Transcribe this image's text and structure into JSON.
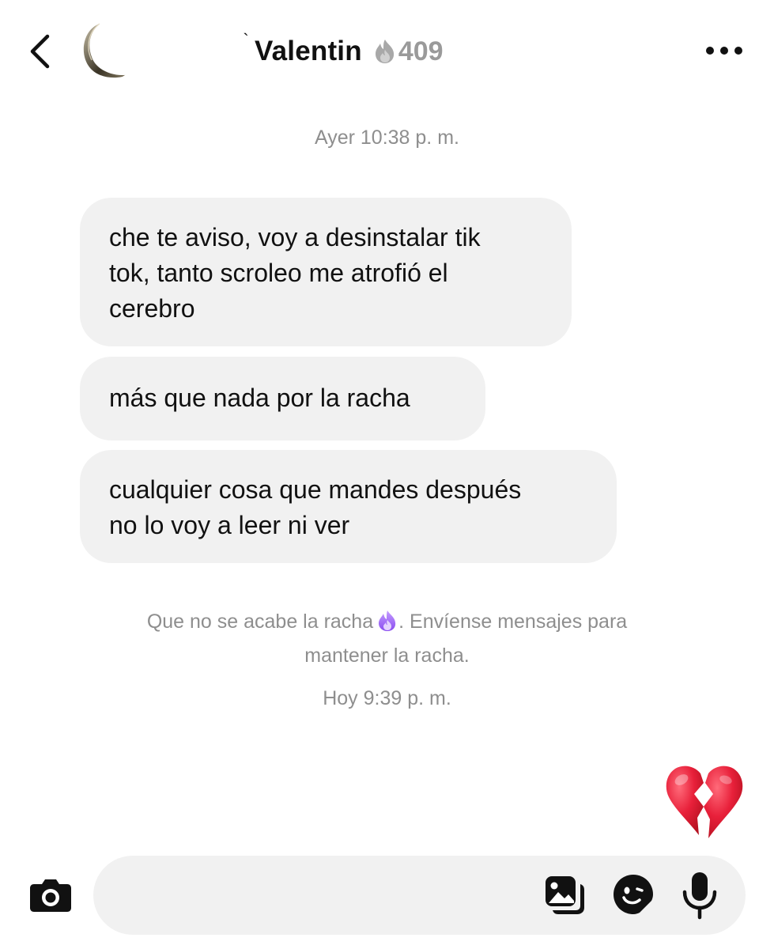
{
  "header": {
    "back_label": "Back",
    "tick": "`",
    "contact_name": "Valentin",
    "streak_count": "409",
    "streak_icon": "fire-icon",
    "more_icon": "more-dots-icon"
  },
  "conversation": {
    "timestamp_yesterday": "Ayer 10:38 p. m.",
    "messages": [
      {
        "lines": [
          "che te aviso, voy a desinstalar tik",
          "tok, tanto scroleo me atrofió el",
          "cerebro"
        ]
      },
      {
        "lines": [
          "más que nada por la racha"
        ]
      },
      {
        "lines": [
          "cualquier cosa que mandes después",
          "no lo voy a leer ni ver"
        ]
      }
    ],
    "streak_notice": {
      "part1": "Que no se acabe la racha",
      "part2": ". Envíense mensajes para",
      "part3": "mantener la racha."
    },
    "timestamp_today": "Hoy 9:39 p. m.",
    "reaction_emoji": "broken-heart-icon"
  },
  "composer": {
    "placeholder": "",
    "value": "",
    "icons": [
      "camera-icon",
      "gallery-icon",
      "sticker-icon",
      "microphone-icon"
    ]
  },
  "colors": {
    "bubble_bg": "#f1f1f1",
    "meta_text": "#8e8e8e",
    "streak_gray": "#9a9a9a",
    "notice_fire": "#a070f0",
    "broken_heart": "#e02238"
  }
}
